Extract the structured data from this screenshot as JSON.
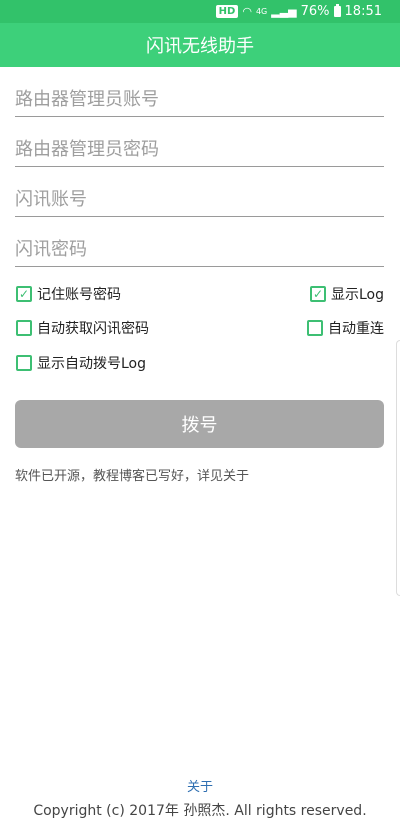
{
  "status": {
    "hd": "HD",
    "network": "4G",
    "battery": "76%",
    "time": "18:51"
  },
  "app": {
    "title": "闪讯无线助手"
  },
  "fields": {
    "router_account": {
      "placeholder": "路由器管理员账号",
      "value": ""
    },
    "router_password": {
      "placeholder": "路由器管理员密码",
      "value": ""
    },
    "shanxun_account": {
      "placeholder": "闪讯账号",
      "value": ""
    },
    "shanxun_password": {
      "placeholder": "闪讯密码",
      "value": ""
    }
  },
  "options": {
    "remember": {
      "label": "记住账号密码",
      "checked": true
    },
    "show_log": {
      "label": "显示Log",
      "checked": true
    },
    "auto_get_password": {
      "label": "自动获取闪讯密码",
      "checked": false
    },
    "auto_reconnect": {
      "label": "自动重连",
      "checked": false
    },
    "show_auto_dial_log": {
      "label": "显示自动拨号Log",
      "checked": false
    }
  },
  "dial_button": {
    "label": "拨号"
  },
  "note": "软件已开源，教程博客已写好，详见关于",
  "footer": {
    "about_link": "关于",
    "copyright": "Copyright (c) 2017年 孙照杰. All rights reserved."
  },
  "colors": {
    "status_bar": "#32c26a",
    "app_bar": "#3dd07a",
    "accent": "#3dbf73",
    "button_disabled": "#a8a8a8",
    "link": "#2f6fb1"
  }
}
